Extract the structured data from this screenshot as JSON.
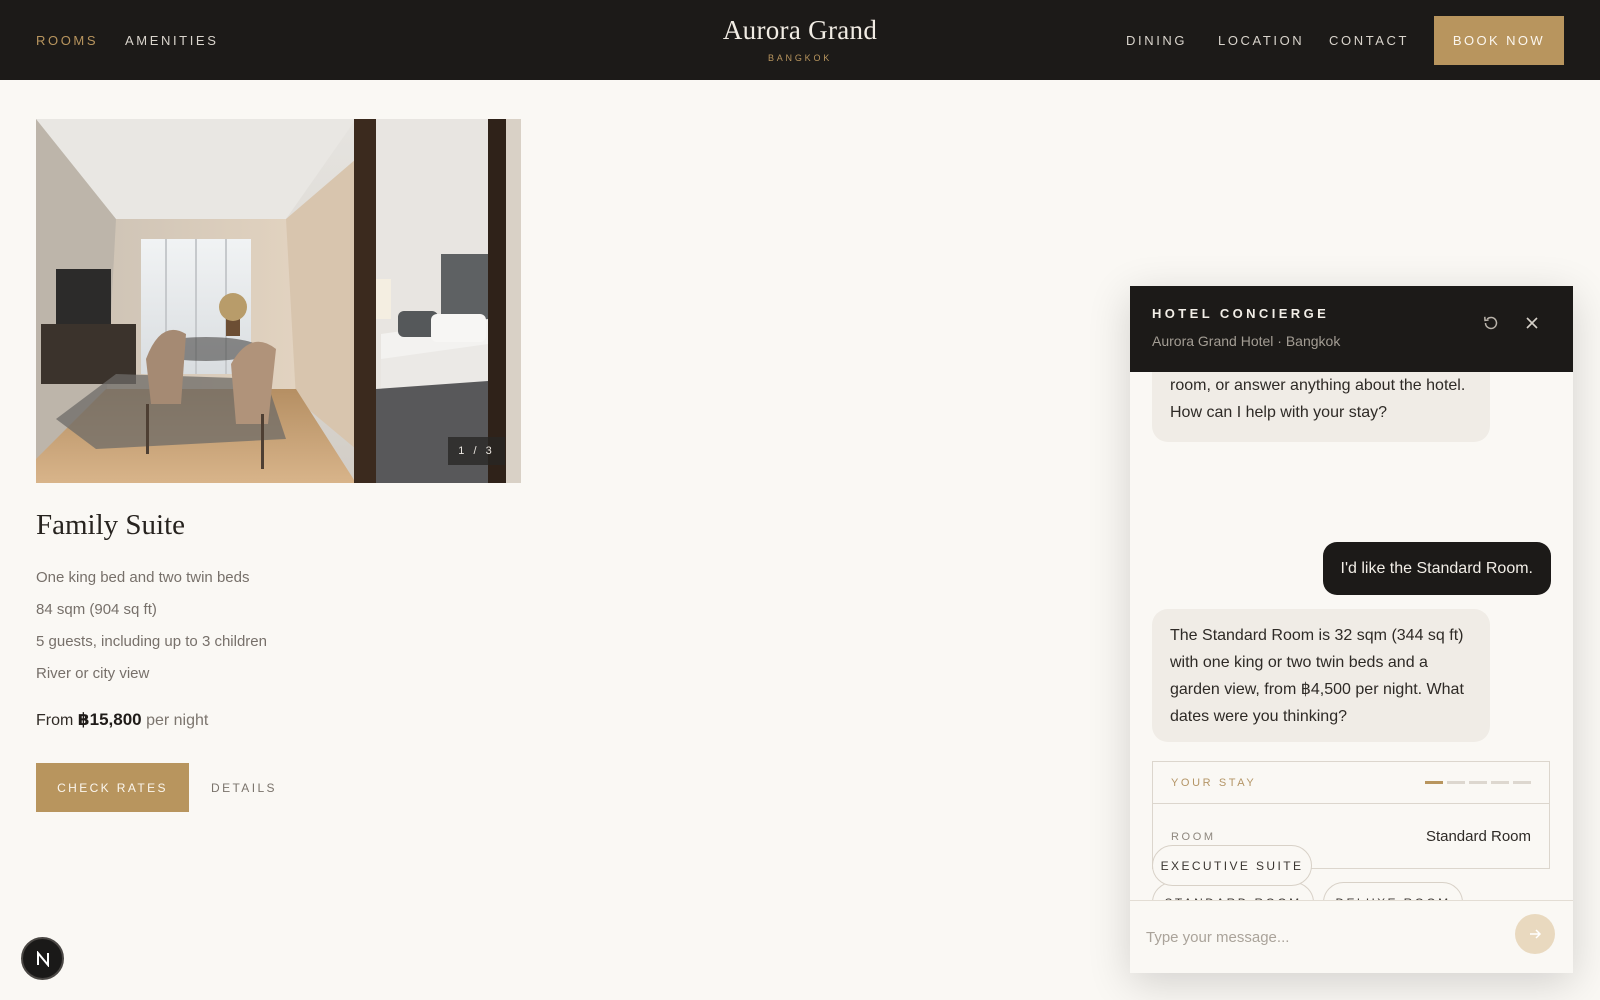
{
  "nav": {
    "left_links": [
      {
        "label": "ROOMS"
      },
      {
        "label": "AMENITIES"
      }
    ],
    "brand_title": "Aurora Grand",
    "brand_subtitle": "BANGKOK",
    "right_links": [
      {
        "label": "DINING"
      },
      {
        "label": "LOCATION"
      },
      {
        "label": "CONTACT"
      }
    ],
    "book_label": "BOOK NOW"
  },
  "room": {
    "photo_counter": "1 / 3",
    "photo_current": 1,
    "photo_total": 3,
    "title": "Family Suite",
    "features": [
      "One king bed and two twin beds",
      "84 sqm (904 sq ft)",
      "5 guests, including up to 3 children",
      "River or city view"
    ],
    "price_prefix": "From",
    "price_amount": "฿15,800",
    "price_unit": "per night",
    "check_rates_label": "CHECK RATES",
    "details_label": "DETAILS"
  },
  "chat": {
    "title": "HOTEL CONCIERGE",
    "subtitle": "Aurora Grand Hotel · Bangkok",
    "messages": [
      {
        "role": "bot",
        "text": "room, or answer anything about the hotel. How can I help with your stay?"
      },
      {
        "role": "user",
        "text": "I'd like the Standard Room."
      },
      {
        "role": "bot",
        "text": "The Standard Room is 32 sqm (344 sq ft) with one king or two twin beds and a garden view, from ฿4,500 per night. What dates were you thinking?"
      }
    ],
    "stay": {
      "label": "YOUR STAY",
      "step_current": 1,
      "step_total": 5,
      "room_key": "ROOM",
      "room_value": "Standard Room"
    },
    "chips": [
      {
        "label": "STANDARD ROOM"
      },
      {
        "label": "DELUXE ROOM"
      },
      {
        "label": "EXECUTIVE SUITE"
      }
    ],
    "input_placeholder": "Type your message..."
  },
  "colors": {
    "nav_bg": "#1c1a18",
    "accent_gold": "#b8955e",
    "page_bg": "#faf8f4",
    "bot_bubble": "#f0ece6",
    "user_bubble": "#1c1a18"
  },
  "icons": {
    "refresh": "refresh-icon",
    "close": "close-icon",
    "send": "arrow-right-icon",
    "fab": "n-logo-icon"
  }
}
